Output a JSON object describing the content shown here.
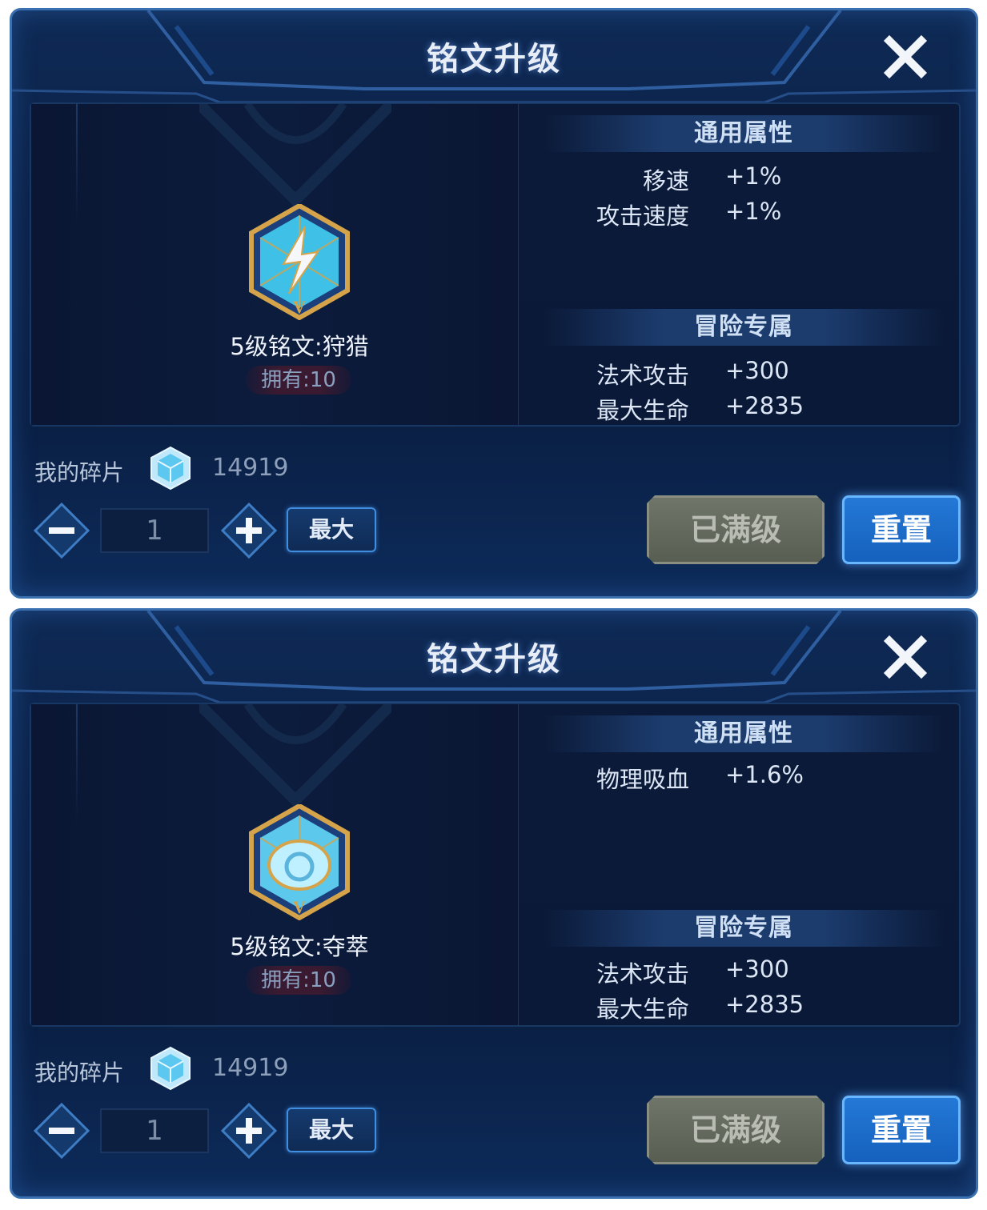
{
  "colors": {
    "panel_bg": "#0b2148",
    "accent_blue": "#2478d6",
    "disabled_gray": "#6f7568",
    "gold": "#d4a34a"
  },
  "panels": [
    {
      "title": "铭文升级",
      "rune": {
        "name": "5级铭文:狩猎",
        "owned": "拥有:10",
        "icon": "lightning-rune-icon"
      },
      "general": {
        "heading": "通用属性",
        "attrs": [
          {
            "label": "移速",
            "value": "+1%"
          },
          {
            "label": "攻击速度",
            "value": "+1%"
          }
        ]
      },
      "adventure": {
        "heading": "冒险专属",
        "attrs": [
          {
            "label": "法术攻击",
            "value": "+300"
          },
          {
            "label": "最大生命",
            "value": "+2835"
          }
        ]
      },
      "fragments": {
        "label": "我的碎片",
        "count": "14919",
        "icon": "crystal-icon"
      },
      "quantity": "1",
      "buttons": {
        "max": "最大",
        "max_level": "已满级",
        "reset": "重置"
      }
    },
    {
      "title": "铭文升级",
      "rune": {
        "name": "5级铭文:夺萃",
        "owned": "拥有:10",
        "icon": "orb-rune-icon"
      },
      "general": {
        "heading": "通用属性",
        "attrs": [
          {
            "label": "物理吸血",
            "value": "+1.6%"
          }
        ]
      },
      "adventure": {
        "heading": "冒险专属",
        "attrs": [
          {
            "label": "法术攻击",
            "value": "+300"
          },
          {
            "label": "最大生命",
            "value": "+2835"
          }
        ]
      },
      "fragments": {
        "label": "我的碎片",
        "count": "14919",
        "icon": "crystal-icon"
      },
      "quantity": "1",
      "buttons": {
        "max": "最大",
        "max_level": "已满级",
        "reset": "重置"
      }
    }
  ]
}
